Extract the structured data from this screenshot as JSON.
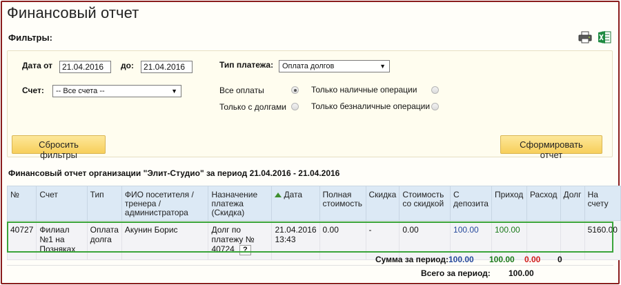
{
  "page": {
    "title": "Финансовый отчет"
  },
  "filters": {
    "label": "Фильтры:",
    "date_from_label": "Дата от",
    "date_from_value": "21.04.2016",
    "date_to_label": "до:",
    "date_to_value": "21.04.2016",
    "payment_type_label": "Тип платежа:",
    "payment_type_value": "Оплата долгов",
    "account_label": "Счет:",
    "account_value": "-- Все счета --",
    "radio_all": "Все оплаты",
    "radio_debts": "Только с долгами",
    "radio_cash": "Только наличные операции",
    "radio_cashless": "Только безналичные операции",
    "reset_button": "Сбросить фильтры",
    "generate_button": "Сформировать отчет"
  },
  "toolbar": {
    "icons": [
      "printer-icon",
      "excel-icon"
    ]
  },
  "report": {
    "title": "Финансовый отчет организации \"Элит-Студио\" за период 21.04.2016 - 21.04.2016",
    "columns": [
      "№",
      "Счет",
      "Тип",
      "ФИО посетителя / тренера / администратора",
      "Назначение платежа (Скидка)",
      "Дата",
      "Полная стоимость",
      "Скидка",
      "Стоимость со скидкой",
      "С депозита",
      "Приход",
      "Расход",
      "Долг",
      "На счету"
    ],
    "rows": [
      {
        "num": "40727",
        "account": "Филиал №1 на Позняках",
        "type": "Оплата долга",
        "person": "Акунин Борис",
        "purpose": "Долг по платежу № 40724",
        "help": "?",
        "date": "21.04.2016 13:43",
        "full_cost": "0.00",
        "discount": "-",
        "discounted_cost": "0.00",
        "from_deposit": "100.00",
        "income": "100.00",
        "expense": "",
        "debt": "",
        "balance": "5160.00"
      }
    ],
    "sum_label": "Сумма за период:",
    "sum_deposit": "100.00",
    "sum_income": "100.00",
    "sum_expense": "0.00",
    "sum_debt": "0",
    "total_label": "Всего за период:",
    "total_value": "100.00"
  },
  "colors": {
    "accent_blue": "#26499c",
    "accent_green": "#1b7a1b",
    "accent_red": "#d21a1a",
    "button_yellow": "#f7cf5a",
    "frame_red": "#8a1c1c"
  }
}
